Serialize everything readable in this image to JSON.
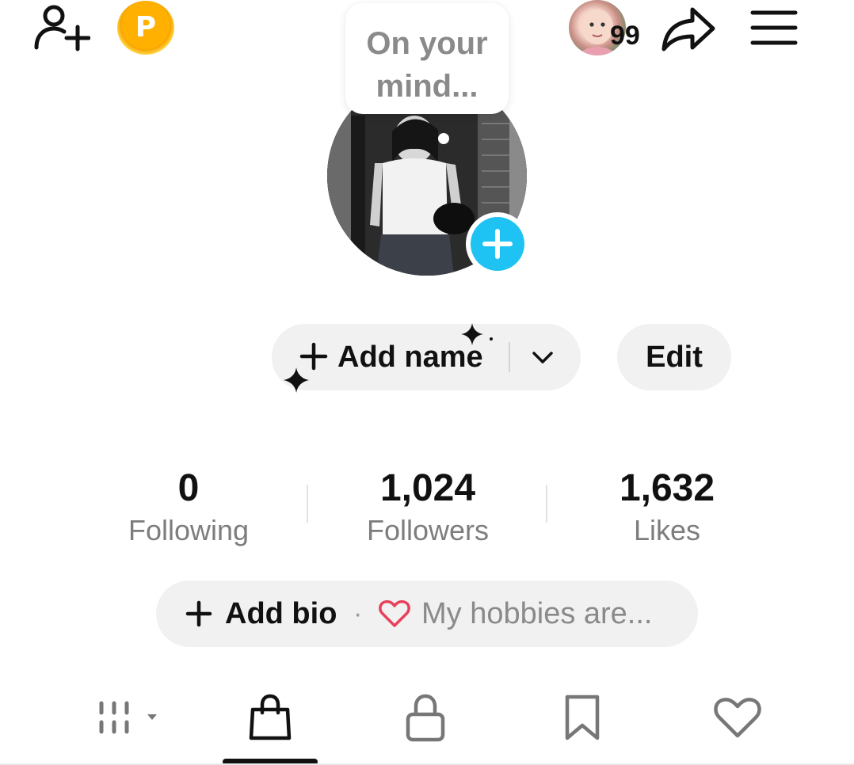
{
  "top_bar": {
    "coin_letter": "P",
    "friend_badge_count": "99"
  },
  "thought_bubble": {
    "line1": "On your",
    "line2": "mind..."
  },
  "profile": {
    "add_name_label": "Add name",
    "edit_label": "Edit"
  },
  "stats": [
    {
      "value": "0",
      "label": "Following"
    },
    {
      "value": "1,024",
      "label": "Followers"
    },
    {
      "value": "1,632",
      "label": "Likes"
    }
  ],
  "bio": {
    "add_label": "Add bio",
    "separator": "·",
    "hint": "My hobbies are..."
  },
  "tabs": {
    "icons": [
      "grid-filter-icon",
      "shopping-bag-icon",
      "lock-icon",
      "bookmark-icon",
      "heart-icon"
    ],
    "active": "shopping-bag-icon"
  },
  "colors": {
    "accent_blue": "#1fc3f3",
    "coin_orange": "#ffb000",
    "heart_red": "#e8405a",
    "pill_bg": "#f1f1f1",
    "muted_text": "#7d7d7d"
  }
}
